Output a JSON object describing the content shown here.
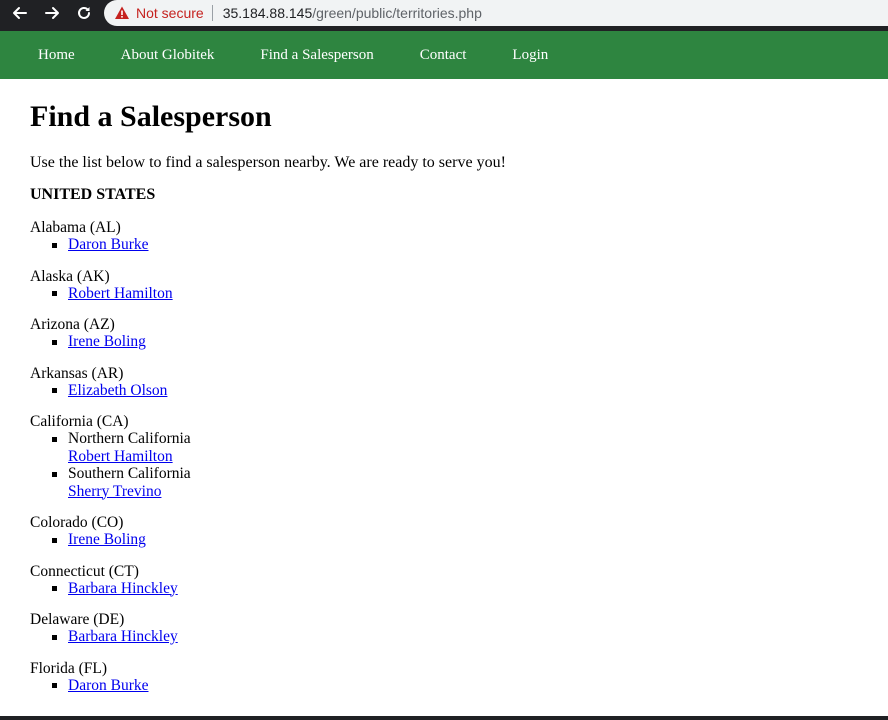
{
  "browser": {
    "security_label": "Not secure",
    "url_host": "35.184.88.145",
    "url_path": "/green/public/territories.php"
  },
  "nav": {
    "items": [
      "Home",
      "About Globitek",
      "Find a Salesperson",
      "Contact",
      "Login"
    ]
  },
  "page": {
    "title": "Find a Salesperson",
    "intro": "Use the list below to find a salesperson nearby. We are ready to serve you!",
    "country": "UNITED STATES"
  },
  "states": [
    {
      "name": "Alabama (AL)",
      "people": [
        "Daron Burke"
      ]
    },
    {
      "name": "Alaska (AK)",
      "people": [
        "Robert Hamilton"
      ]
    },
    {
      "name": "Arizona (AZ)",
      "people": [
        "Irene Boling"
      ]
    },
    {
      "name": "Arkansas (AR)",
      "people": [
        "Elizabeth Olson"
      ]
    },
    {
      "name": "California (CA)",
      "regions": [
        {
          "region": "Northern California",
          "person": "Robert Hamilton"
        },
        {
          "region": "Southern California",
          "person": "Sherry Trevino"
        }
      ]
    },
    {
      "name": "Colorado (CO)",
      "people": [
        "Irene Boling"
      ]
    },
    {
      "name": "Connecticut (CT)",
      "people": [
        "Barbara Hinckley"
      ]
    },
    {
      "name": "Delaware (DE)",
      "people": [
        "Barbara Hinckley"
      ]
    },
    {
      "name": "Florida (FL)",
      "people": [
        "Daron Burke"
      ]
    }
  ],
  "colors": {
    "nav_bg": "#2e8540",
    "link": "#0000ee",
    "warning": "#c5221f"
  }
}
